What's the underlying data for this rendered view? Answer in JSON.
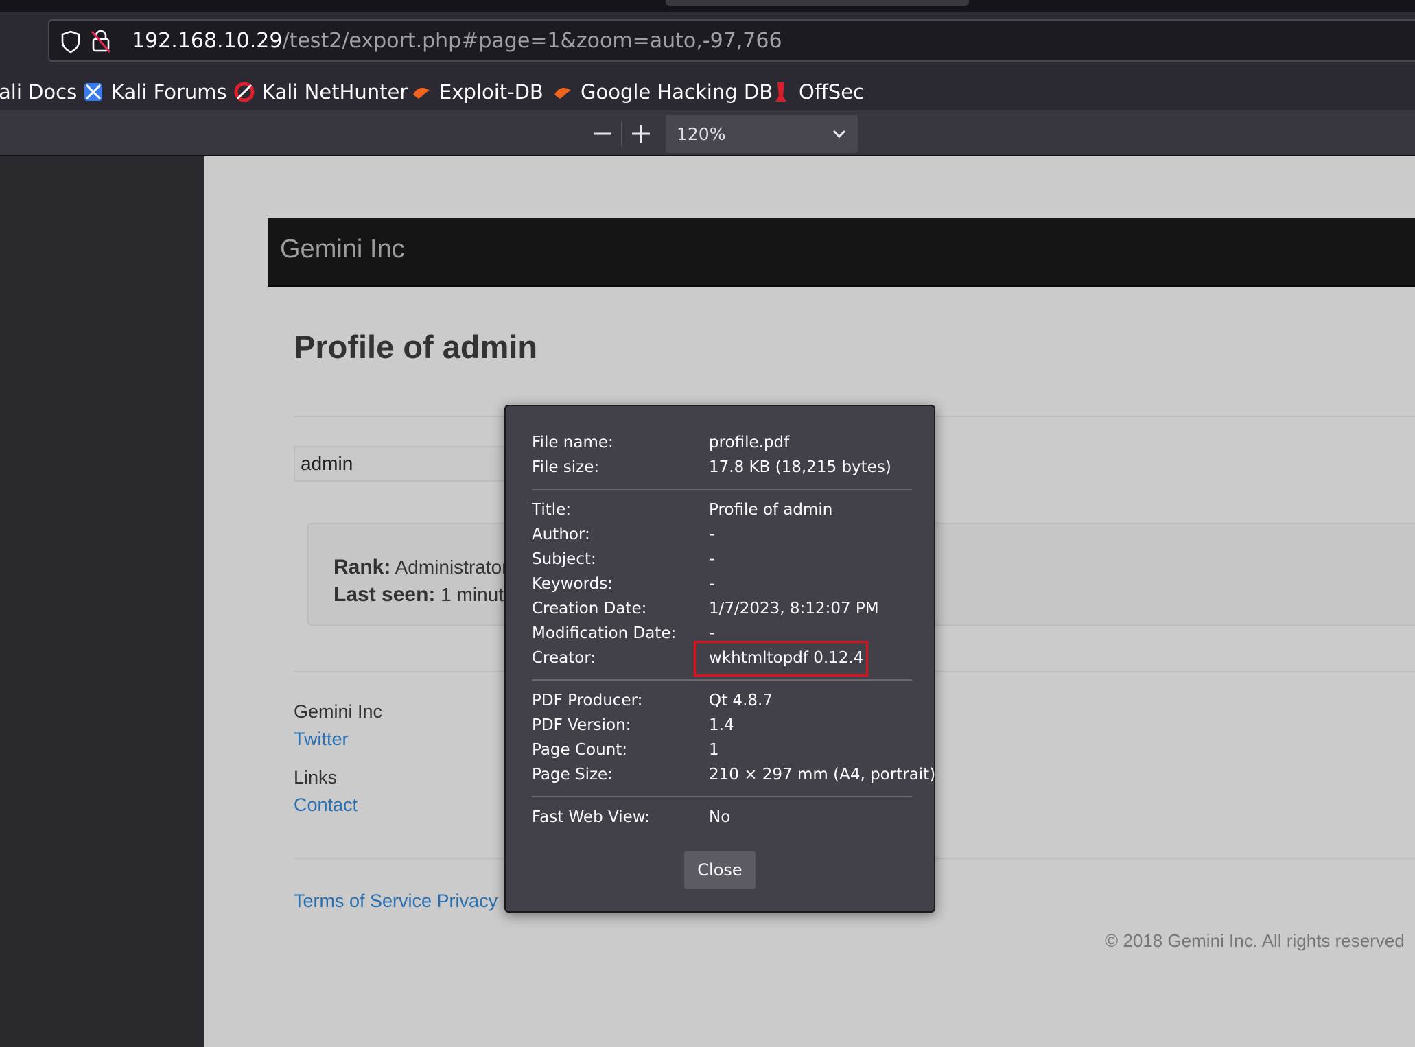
{
  "browser": {
    "url_host": "192.168.10.29",
    "url_path": "/test2/export.php#page=1&zoom=auto,-97,766"
  },
  "bookmarks": [
    {
      "label": "ali Docs"
    },
    {
      "label": "Kali Forums"
    },
    {
      "label": "Kali NetHunter"
    },
    {
      "label": "Exploit-DB"
    },
    {
      "label": "Google Hacking DB"
    },
    {
      "label": "OffSec"
    }
  ],
  "pdf_toolbar": {
    "zoom_value": "120%"
  },
  "page": {
    "brand": "Gemini Inc",
    "profile_title": "Profile of admin",
    "name_value": "admin",
    "rank_label": "Rank:",
    "rank_value": "Administrator",
    "last_seen_label": "Last seen:",
    "last_seen_value": "1 minute",
    "footer_company": "Gemini Inc",
    "footer_twitter": "Twitter",
    "footer_links_heading": "Links",
    "footer_contact": "Contact",
    "footer_terms": "Terms of Service Privacy",
    "copyright": "© 2018 Gemini Inc. All rights reserved"
  },
  "dialog": {
    "rows": [
      {
        "label": "File name:",
        "value": "profile.pdf"
      },
      {
        "label": "File size:",
        "value": "17.8 KB (18,215 bytes)"
      },
      {
        "label": "Title:",
        "value": "Profile of admin"
      },
      {
        "label": "Author:",
        "value": "-"
      },
      {
        "label": "Subject:",
        "value": "-"
      },
      {
        "label": "Keywords:",
        "value": "-"
      },
      {
        "label": "Creation Date:",
        "value": "1/7/2023, 8:12:07 PM"
      },
      {
        "label": "Modification Date:",
        "value": "-"
      },
      {
        "label": "Creator:",
        "value": "wkhtmltopdf 0.12.4"
      },
      {
        "label": "PDF Producer:",
        "value": "Qt 4.8.7"
      },
      {
        "label": "PDF Version:",
        "value": "1.4"
      },
      {
        "label": "Page Count:",
        "value": "1"
      },
      {
        "label": "Page Size:",
        "value": "210 × 297 mm (A4, portrait)"
      },
      {
        "label": "Fast Web View:",
        "value": "No"
      }
    ],
    "close_label": "Close",
    "highlight_color": "#e0101a"
  }
}
